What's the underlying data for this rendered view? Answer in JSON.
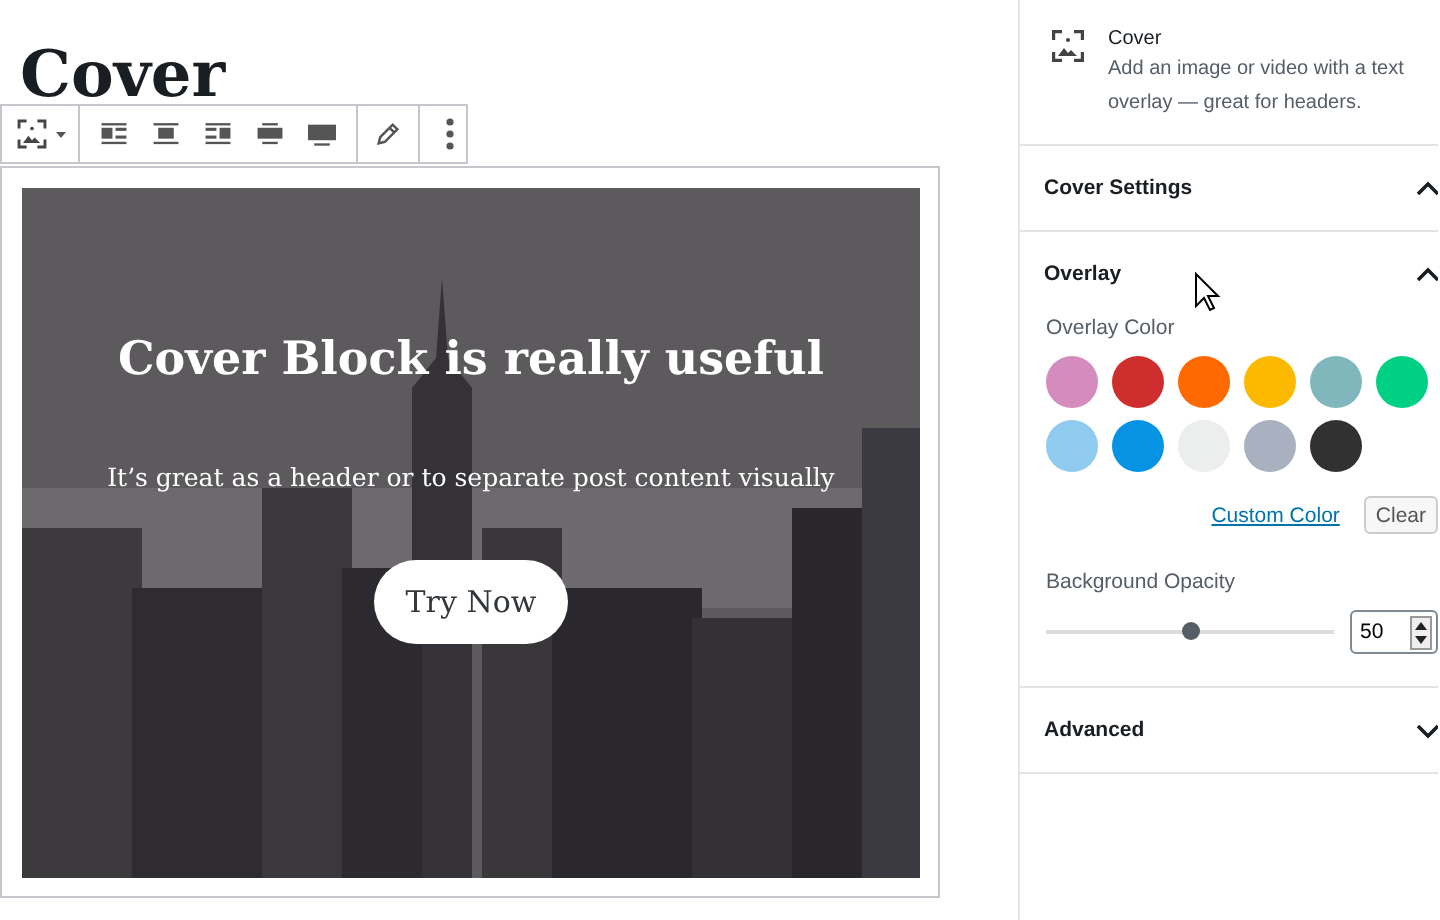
{
  "editor": {
    "title": "Cover",
    "cover": {
      "heading": "Cover Block is really useful",
      "text": "It’s great as a header or to separate post content visually",
      "button": "Try Now"
    }
  },
  "sidebar": {
    "block": {
      "name": "Cover",
      "description": "Add an image or video with a text overlay — great for headers."
    },
    "panels": [
      {
        "kind": "plain",
        "title": "Cover Settings",
        "expanded": true
      },
      {
        "kind": "overlay",
        "title": "Overlay",
        "expanded": true,
        "color_label": "Overlay Color",
        "swatches": [
          {
            "color": "#d48cbe",
            "selected": false
          },
          {
            "color": "#cf2e2e",
            "selected": false
          },
          {
            "color": "#ff6900",
            "selected": false
          },
          {
            "color": "#fcb900",
            "selected": false
          },
          {
            "color": "#7fb7bd",
            "selected": false
          },
          {
            "color": "#00d084",
            "selected": false
          },
          {
            "color": "#8ecbef",
            "selected": false
          },
          {
            "color": "#0693e3",
            "selected": false
          },
          {
            "color": "#eceeee",
            "selected": false
          },
          {
            "color": "#a9b1c0",
            "selected": false
          },
          {
            "color": "#313131",
            "selected": false
          }
        ],
        "custom_color": "Custom Color",
        "clear": "Clear",
        "opacity_label": "Background Opacity",
        "opacity": {
          "level": 0.5,
          "value": "50"
        }
      },
      {
        "kind": "plain",
        "title": "Advanced",
        "expanded": false
      }
    ]
  }
}
